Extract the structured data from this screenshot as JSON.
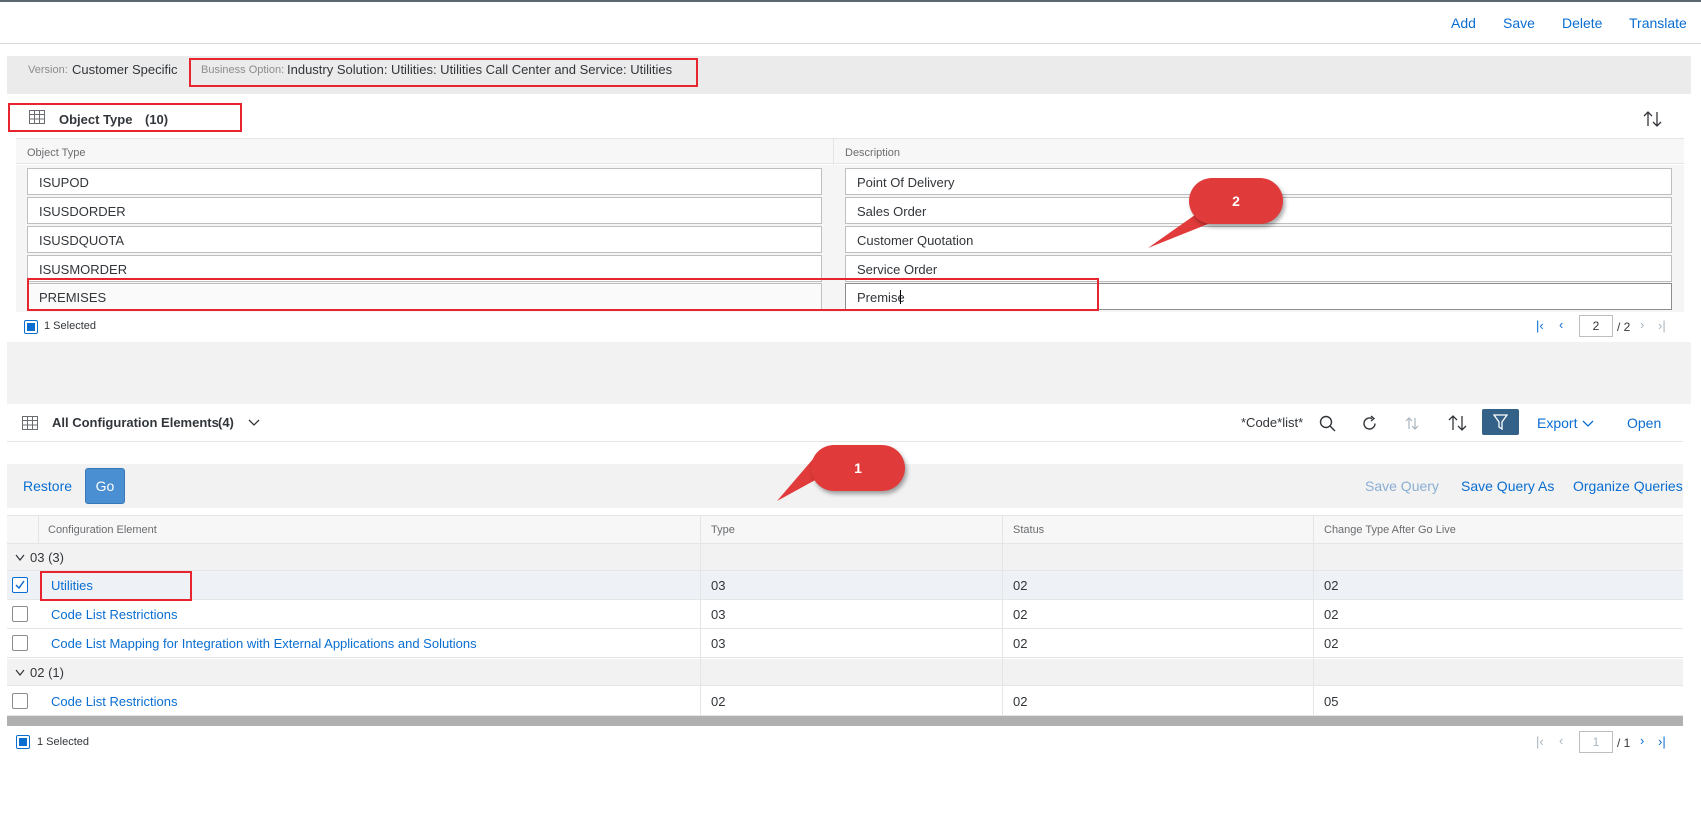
{
  "toolbar": {
    "add": "Add",
    "save": "Save",
    "delete": "Delete",
    "translate": "Translate"
  },
  "header": {
    "version_label": "Version:",
    "version_value": "Customer Specific",
    "business_option_label": "Business Option:",
    "business_option_value": "Industry Solution: Utilities: Utilities Call Center and Service: Utilities"
  },
  "object_type": {
    "title": "Object Type",
    "count": "(10)",
    "col_object_type": "Object Type",
    "col_description": "Description",
    "rows": [
      {
        "type": "ISUPOD",
        "description": "Point Of Delivery"
      },
      {
        "type": "ISUSDORDER",
        "description": "Sales Order"
      },
      {
        "type": "ISUSDQUOTA",
        "description": "Customer Quotation"
      },
      {
        "type": "ISUSMORDER",
        "description": "Service Order"
      },
      {
        "type": "PREMISES",
        "description": "Premise"
      }
    ],
    "selected_text": "1 Selected",
    "page_current": "2",
    "page_total": "/ 2"
  },
  "callouts": {
    "one": "1",
    "two": "2"
  },
  "config": {
    "title": "All Configuration Elements",
    "count": "(4)",
    "search_query": "*Code*list*",
    "export_label": "Export",
    "open_label": "Open",
    "restore_label": "Restore",
    "go_label": "Go",
    "save_query": "Save Query",
    "save_query_as": "Save Query As",
    "organize_queries": "Organize Queries",
    "col_element": "Configuration Element",
    "col_type": "Type",
    "col_status": "Status",
    "col_change": "Change Type After Go Live",
    "groups": [
      {
        "label": "03 (3)",
        "rows": [
          {
            "element": "Utilities",
            "type": "03",
            "status": "02",
            "change": "02",
            "checked": true
          },
          {
            "element": "Code List Restrictions",
            "type": "03",
            "status": "02",
            "change": "02",
            "checked": false
          },
          {
            "element": "Code List Mapping for Integration with External Applications and Solutions",
            "type": "03",
            "status": "02",
            "change": "02",
            "checked": false
          }
        ]
      },
      {
        "label": "02 (1)",
        "rows": [
          {
            "element": "Code List Restrictions",
            "type": "02",
            "status": "02",
            "change": "05",
            "checked": false
          }
        ]
      }
    ],
    "selected_text": "1 Selected",
    "page_current": "1",
    "page_total": "/ 1"
  },
  "colors": {
    "accent": "#0a6ed1",
    "annotation": "#e8242f",
    "go_button": "#4a8fd1",
    "filter_button": "#346187"
  }
}
